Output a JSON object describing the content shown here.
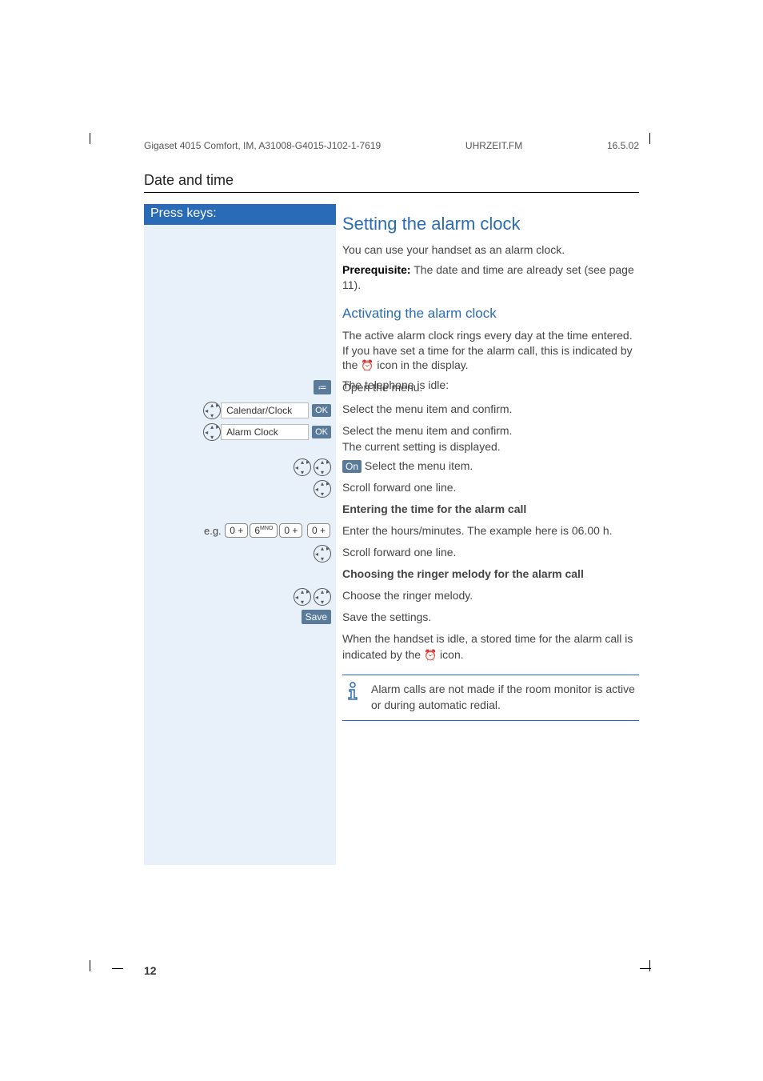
{
  "header": {
    "doc_id": "Gigaset 4015 Comfort, IM, A31008-G4015-J102-1-7619",
    "file": "UHRZEIT.FM",
    "date": "16.5.02"
  },
  "section_title": "Date and time",
  "press_keys_label": "Press keys:",
  "h1": "Setting the alarm clock",
  "p1": "You can use your handset as an alarm clock.",
  "p2a": "Prerequisite:",
  "p2b": " The date and time are already set (see page 11).",
  "h2": "Activating the alarm clock",
  "p3": "The active alarm clock rings every day at the time entered. If you have set a time for the alarm call, this is indicated by the ",
  "p3b": " icon in the display.",
  "p4": "The telephone is idle:",
  "rows": {
    "open_menu": "Open the menu.",
    "calendar_label": "Calendar/Clock",
    "ok_label": "OK",
    "calendar_desc": "Select the menu item and confirm.",
    "alarm_label": "Alarm Clock",
    "alarm_desc_a": "Select the menu item and confirm.",
    "alarm_desc_b": "The current setting is displayed.",
    "on_label": "On",
    "on_desc": " Select the menu item.",
    "scroll1": "Scroll forward one line.",
    "entering_heading": "Entering the time for the alarm call",
    "eg_label": "e.g.",
    "key1": "0 +",
    "key2": "6",
    "key2_sup": "MNO",
    "key3": "0 +",
    "key4": "0 +",
    "enter_desc": "Enter the hours/minutes. The example here is 06.00 h.",
    "scroll2": "Scroll forward one line.",
    "choosing_heading": "Choosing the ringer melody for the alarm call",
    "choose_desc": "Choose the ringer melody.",
    "save_label": "Save",
    "save_desc": "Save the settings.",
    "stored_a": "When the handset is idle, a stored time for the alarm call is indicated by the ",
    "stored_b": " icon."
  },
  "info_note": "Alarm calls are not made if the room monitor is active or during automatic redial.",
  "page_number": "12",
  "icons": {
    "alarm_glyph": "⏰",
    "menu_glyph": "≔"
  }
}
